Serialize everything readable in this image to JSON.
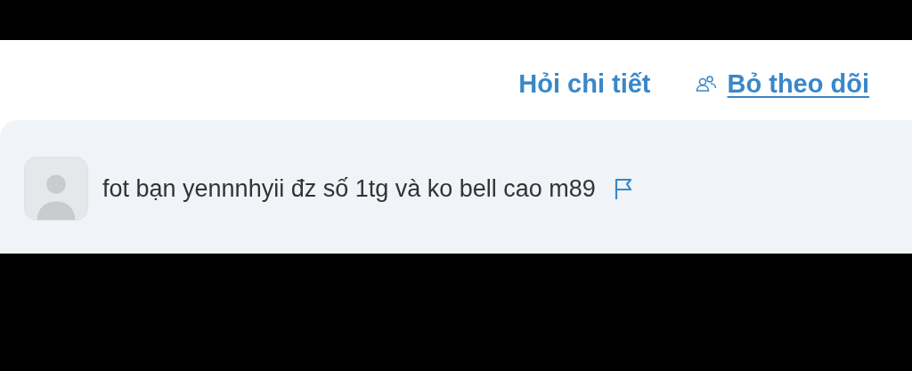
{
  "actions": [
    {
      "kind": "link",
      "label": "Hỏi chi tiết",
      "underlined": false
    },
    {
      "kind": "follow",
      "label": "Bỏ theo dõi",
      "underlined": true
    }
  ],
  "comment": {
    "text": "fot bạn yennnhyii đz số 1tg và ko bell cao m89"
  }
}
